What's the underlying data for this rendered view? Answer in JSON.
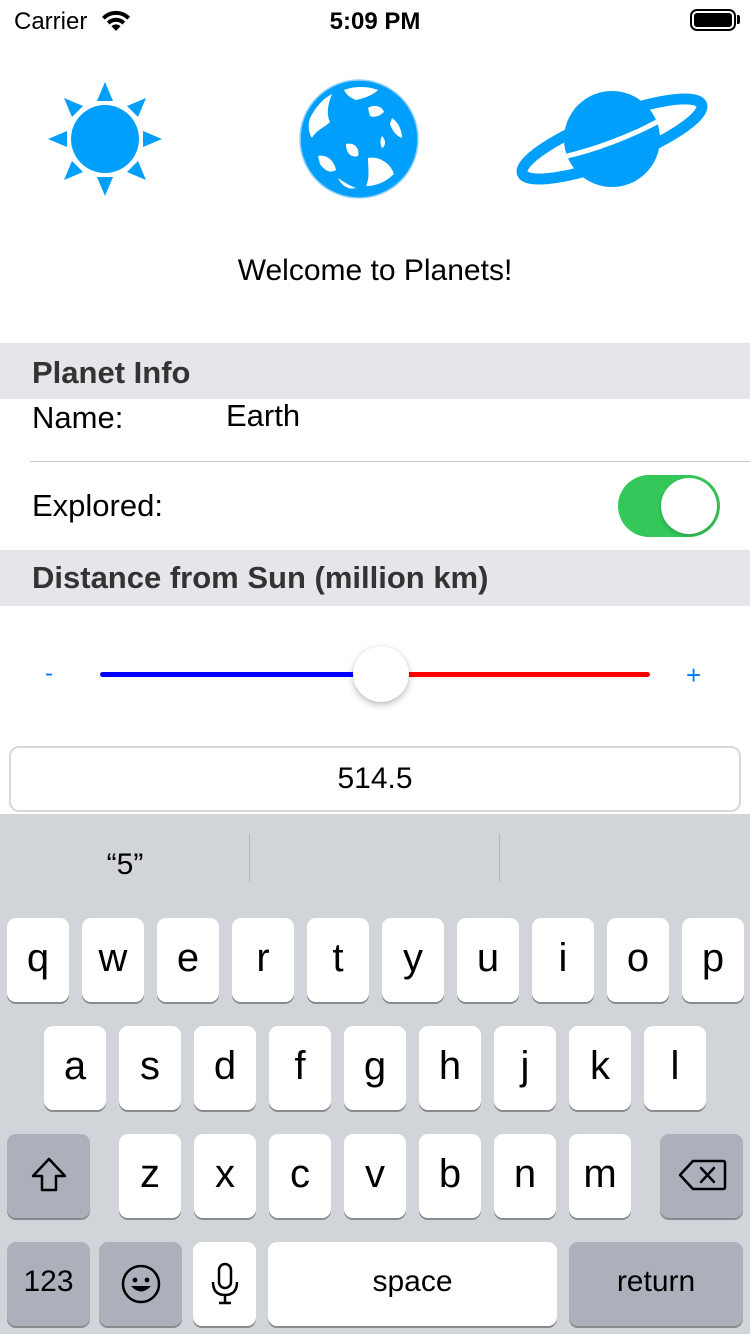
{
  "status_bar": {
    "carrier": "Carrier",
    "time": "5:09 PM"
  },
  "icons": [
    "sun-icon",
    "earth-icon",
    "saturn-icon"
  ],
  "welcome": "Welcome to Planets!",
  "planet_info": {
    "header": "Planet Info",
    "name_label": "Name:",
    "name_value": "Earth",
    "explored_label": "Explored:",
    "explored": true
  },
  "distance": {
    "header": "Distance from Sun (million km)",
    "slider_min_label": "-",
    "slider_max_label": "+",
    "slider_fraction": 0.51,
    "field_value": "514.5"
  },
  "colors": {
    "accent": "#007aff",
    "icon_blue": "#009ffb",
    "toggle_on": "#34c759",
    "track_min": "#0000ff",
    "track_max": "#ff0000"
  },
  "keyboard": {
    "suggestions": [
      "“5”",
      "",
      ""
    ],
    "row1": [
      "q",
      "w",
      "e",
      "r",
      "t",
      "y",
      "u",
      "i",
      "o",
      "p"
    ],
    "row2": [
      "a",
      "s",
      "d",
      "f",
      "g",
      "h",
      "j",
      "k",
      "l"
    ],
    "row3": [
      "z",
      "x",
      "c",
      "v",
      "b",
      "n",
      "m"
    ],
    "shift_icon": "shift-icon",
    "delete_icon": "delete-icon",
    "numbers_label": "123",
    "emoji_icon": "emoji-icon",
    "mic_icon": "microphone-icon",
    "space_label": "space",
    "return_label": "return"
  }
}
